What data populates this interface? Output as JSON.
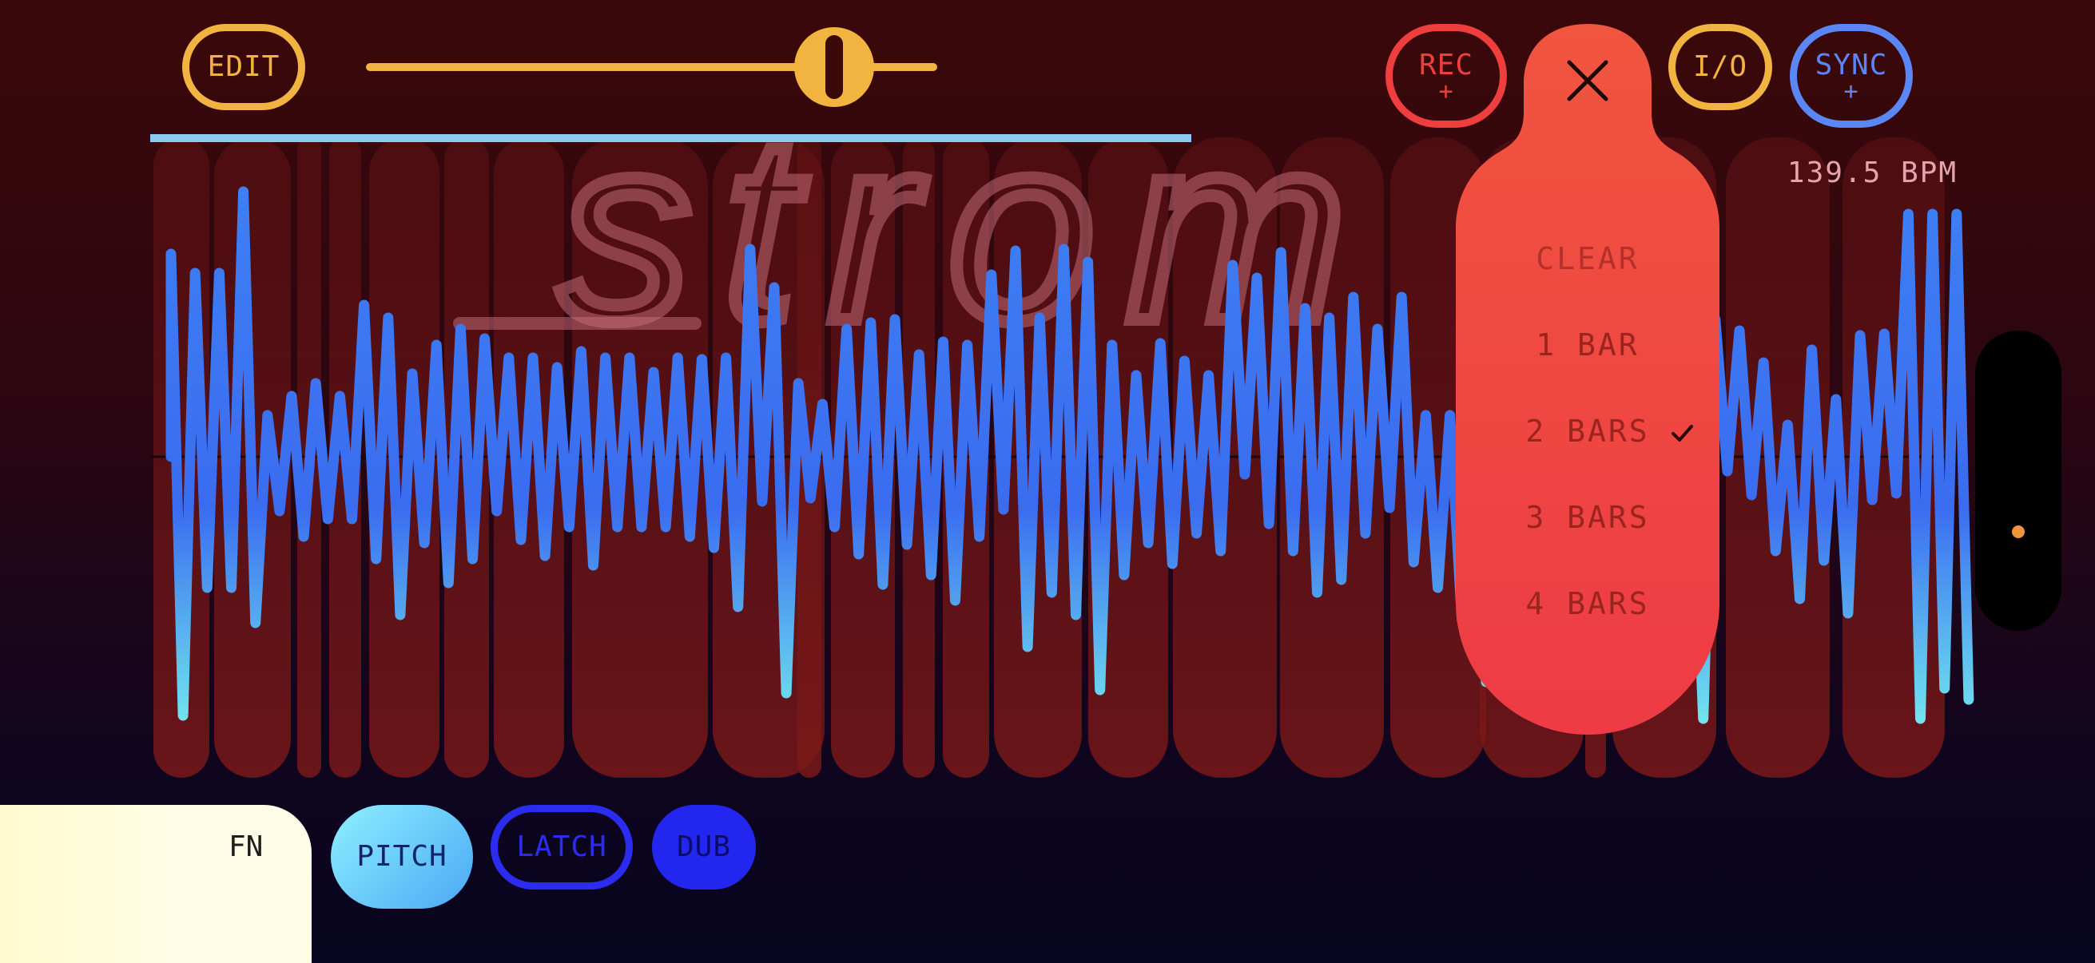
{
  "toolbar": {
    "edit_label": "EDIT",
    "speed_value": 0.82,
    "rec_label": "REC",
    "rec_sub": "+",
    "io_label": "I/O",
    "sync_label": "SYNC",
    "sync_sub": "+"
  },
  "loop_progress": 0.58,
  "bpm_label": "139.5 BPM",
  "logo_text": "strom",
  "length_menu": {
    "close_icon": "close-icon",
    "items": [
      {
        "label": "CLEAR",
        "selected": false
      },
      {
        "label": "1 BAR",
        "selected": false
      },
      {
        "label": "2 BARS",
        "selected": true
      },
      {
        "label": "3 BARS",
        "selected": false
      },
      {
        "label": "4 BARS",
        "selected": false
      }
    ],
    "check_icon": "checkmark-icon"
  },
  "bottom_bar": {
    "fn_label": "FN",
    "pitch_label": "PITCH",
    "latch_label": "LATCH",
    "dub_label": "DUB"
  },
  "colors": {
    "accent_yellow": "#f2b441",
    "rec_red": "#ef3e3e",
    "sync_blue": "#5b86f5",
    "waveform_blue": "#3c7cf2",
    "menu_red": "#f04848",
    "latch_blue": "#2b2cf0",
    "dub_blue": "#2326ee"
  }
}
